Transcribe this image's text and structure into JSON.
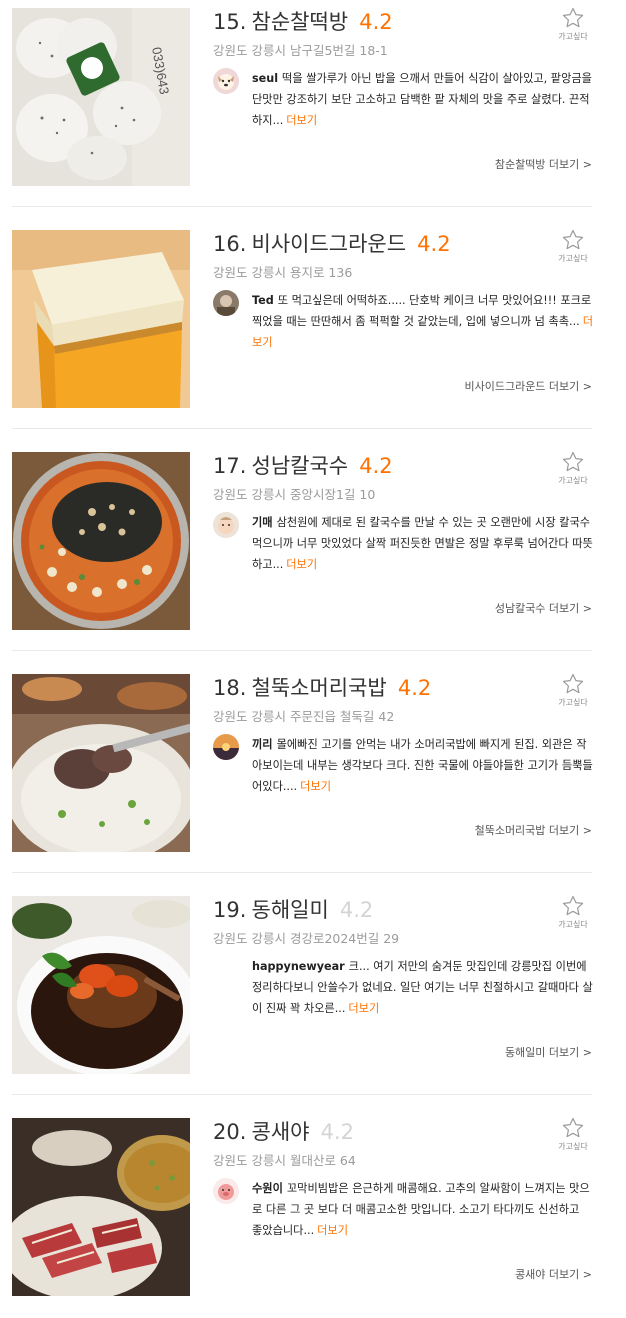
{
  "wish_label": "가고싶다",
  "more_label": "더보기",
  "colors": {
    "accent": "#ff7100",
    "muted_score": "#d4d4d4",
    "address": "#9b9b9b"
  },
  "restaurants": [
    {
      "rank": "15.",
      "name": "참순찰떡방",
      "score": "4.2",
      "score_muted": false,
      "address": "강원도 강릉시 남구길5번길 18-1",
      "review_user": "seul",
      "review_text": "떡을 쌀가루가 아닌 밥을 으깨서 만들어 식감이 살아있고, 팥앙금을 단맛만 강조하기 보단 고소하고 담백한 팥 자체의 맛을 주로 살렸다. 끈적하지...",
      "shop_link": "참순찰떡방 더보기 >",
      "thumb_icon": "rice-cake-photo",
      "avatar_icon": "dog-avatar"
    },
    {
      "rank": "16.",
      "name": "비사이드그라운드",
      "score": "4.2",
      "score_muted": false,
      "address": "강원도 강릉시 용지로 136",
      "review_user": "Ted",
      "review_text": "또 먹고싶은데 어떡하죠..... 단호박 케이크 너무 맛있어요!!! 포크로 찍었을 때는 딴딴해서 좀 퍽퍽할 것 같았는데, 입에 넣으니까 넘 촉촉...",
      "shop_link": "비사이드그라운드 더보기 >",
      "thumb_icon": "cake-photo",
      "avatar_icon": "photo-avatar"
    },
    {
      "rank": "17.",
      "name": "성남칼국수",
      "score": "4.2",
      "score_muted": false,
      "address": "강원도 강릉시 중앙시장1길 10",
      "review_user": "기매",
      "review_text": "삼천원에 제대로 된 칼국수를 만날 수 있는 곳 오랜만에 시장 칼국수 먹으니까 너무 맛있었다 살짝 퍼진듯한 면발은 정말 후루룩 넘어간다 따뜻하고...",
      "shop_link": "성남칼국수 더보기 >",
      "thumb_icon": "noodle-soup-photo",
      "avatar_icon": "baby-avatar"
    },
    {
      "rank": "18.",
      "name": "철뚝소머리국밥",
      "score": "4.2",
      "score_muted": false,
      "address": "강원도 강릉시 주문진읍 철둑길 42",
      "review_user": "끼리",
      "review_text": "몰에빠진 고기를 안먹는 내가 소머리국밥에 빠지게 된집. 외관은 작아보이는데 내부는 생각보다 크다. 진한 국물에 야들야들한 고기가 듬뿍들어있다....",
      "shop_link": "철뚝소머리국밥 더보기 >",
      "thumb_icon": "beef-soup-photo",
      "avatar_icon": "sunset-avatar"
    },
    {
      "rank": "19.",
      "name": "동해일미",
      "score": "4.2",
      "score_muted": true,
      "address": "강원도 강릉시 경강로2024번길 29",
      "review_user": "happynewyear",
      "review_text": "크... 여기 저만의 숨겨둔 맛집인데 강릉맛집 이번에 정리하다보니 안쓸수가 없네요. 일단 여기는 너무 친절하시고 갈때마다 살이 진짜 꽉 차오른...",
      "shop_link": "동해일미 더보기 >",
      "thumb_icon": "crab-photo",
      "avatar_icon": ""
    },
    {
      "rank": "20.",
      "name": "콩새야",
      "score": "4.2",
      "score_muted": true,
      "address": "강원도 강릉시 월대산로 64",
      "review_user": "수원이",
      "review_text": "꼬막비빔밥은 은근하게 매콤해요. 고추의 알싸함이 느껴지는 맛으로 다른 그 곳 보다 더 매콤고소한 맛입니다. 소고기 타다끼도 신선하고 좋았습니다...",
      "shop_link": "콩새야 더보기 >",
      "thumb_icon": "beef-tataki-photo",
      "avatar_icon": "pig-avatar"
    }
  ]
}
